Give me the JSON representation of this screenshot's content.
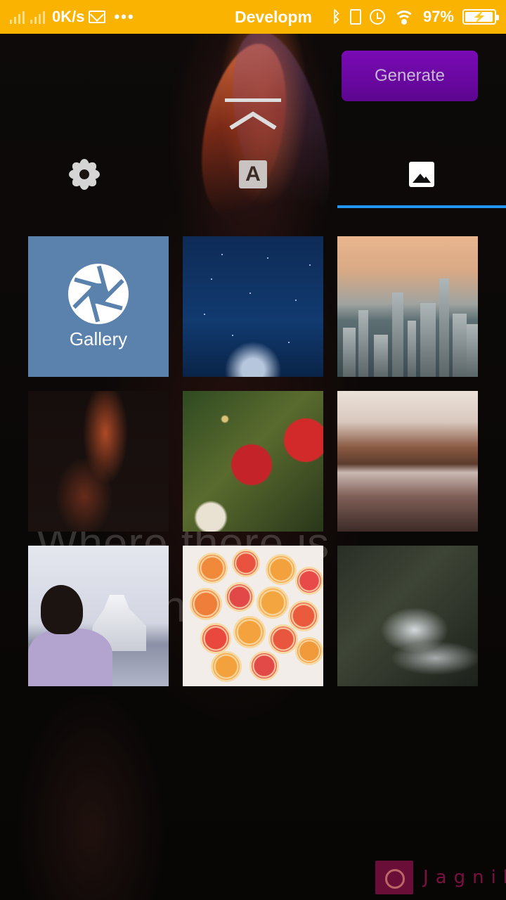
{
  "status_bar": {
    "speed": "0K/s",
    "dots": "•••",
    "title": "Developm",
    "battery_percent": "97%",
    "battery_level": 0.97,
    "icons": [
      "signal-icon",
      "signal-icon",
      "mail-icon",
      "bluetooth-icon",
      "battery-saver-icon",
      "alarm-icon",
      "wifi-icon",
      "battery-charging-icon"
    ]
  },
  "header": {
    "generate_label": "Generate",
    "collapse_icon": "chevron-up-bar-icon",
    "accent_color": "#6a08a3"
  },
  "tabs": [
    {
      "icon": "flower-icon",
      "active": false
    },
    {
      "icon": "text-icon",
      "label": "A",
      "active": false
    },
    {
      "icon": "image-icon",
      "active": true
    }
  ],
  "grid": {
    "gallery_label": "Gallery",
    "gallery_icon": "aperture-icon",
    "thumbnails": [
      "night-sky",
      "city-skyline",
      "canyon",
      "christmas-ornament",
      "misty-lake",
      "child-with-ship",
      "citrus-slices",
      "forest-river"
    ]
  },
  "background": {
    "quote_line1": "Where there is",
    "quote_line2": "h"
  },
  "watermark": {
    "text": "Jagnik",
    "icon": "camera-icon"
  },
  "colors": {
    "status_bar": "#f9b300",
    "tab_indicator": "#2196f3",
    "gallery_tile": "#5a82ad"
  }
}
